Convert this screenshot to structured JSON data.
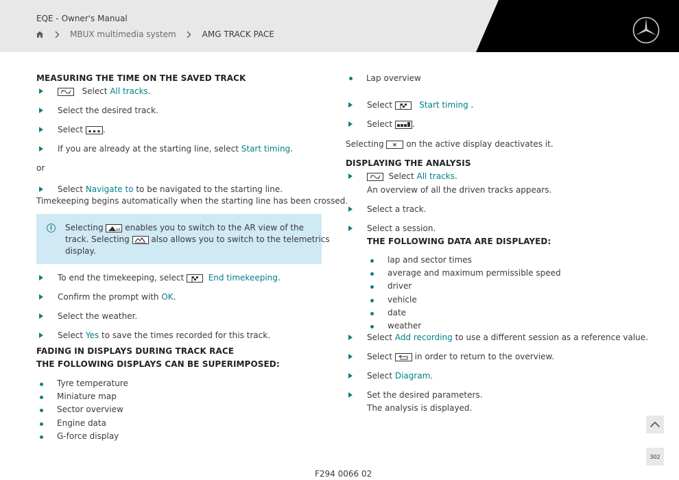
{
  "header": {
    "doc_title": "EQE - Owner's Manual",
    "breadcrumb": [
      "MBUX multimedia system",
      "AMG TRACK PACE"
    ]
  },
  "left": {
    "h1": "MEASURING THE TIME ON THE SAVED TRACK",
    "s1_pre": "Select ",
    "s1_link": "All tracks",
    "s1_post": ".",
    "s2": "Select the desired track.",
    "s3_pre": "Select ",
    "s3_post": ".",
    "s4_pre": "If you are already at the starting line, select ",
    "s4_link": "Start timing",
    "s4_post": ".",
    "or": "or",
    "s5_pre": "Select ",
    "s5_link": "Navigate to",
    "s5_post": " to be navigated to the starting line.",
    "s5_note": "Timekeeping begins automatically when the starting line has been crossed.",
    "info_l1_pre": "Selecting ",
    "info_l1_post": " enables you to switch to the AR view of the",
    "info_l2_pre": "track. Selecting ",
    "info_l2_post": " also allows you to switch to the telemetrics",
    "info_l3": "display.",
    "s6_pre": "To end the timekeeping, select ",
    "s6_link": "End timekeeping",
    "s6_post": ".",
    "s7_pre": "Confirm the prompt with ",
    "s7_link": "OK",
    "s7_post": ".",
    "s8": "Select the weather.",
    "s9_pre": "Select ",
    "s9_link": "Yes",
    "s9_post": " to save the times recorded for this track.",
    "h2": "FADING IN DISPLAYS DURING TRACK RACE",
    "h3": "THE FOLLOWING DISPLAYS CAN BE SUPERIMPOSED:",
    "bullets": [
      "Tyre temperature",
      "Miniature map",
      "Sector overview",
      "Engine data",
      "G-force display"
    ]
  },
  "right": {
    "lap": "Lap overview",
    "r1_pre": "Select ",
    "r1_link": "Start timing",
    "r1_post": " .",
    "r2_pre": "Select ",
    "r2_post": ".",
    "r3_pre": "Selecting ",
    "r3_post": " on the active display deactivates it.",
    "h1": "DISPLAYING THE ANALYSIS",
    "r4_pre": "Select ",
    "r4_link": "All tracks",
    "r4_post": ".",
    "r4_note": "An overview of all the driven tracks appears.",
    "r5": "Select a track.",
    "r6": "Select a session.",
    "h2": "THE FOLLOWING DATA ARE DISPLAYED:",
    "bullets": [
      "lap and sector times",
      "average and maximum permissible speed",
      "driver",
      "vehicle",
      "date",
      "weather"
    ],
    "r7_pre": "Select ",
    "r7_link": "Add recording",
    "r7_post": " to use a different session as a reference value.",
    "r8_pre": "Select ",
    "r8_post": " in order to return to the overview.",
    "r9_pre": "Select ",
    "r9_link": "Diagram",
    "r9_post": ".",
    "r10": "Set the desired parameters.",
    "r10_note": "The analysis is displayed."
  },
  "footer": {
    "code": "F294 0066 02",
    "page": "302"
  },
  "colors": {
    "accent": "#0d7f7f",
    "link": "#00808a",
    "info_bg": "#cfe9f5",
    "header_bg": "#e8e8e8"
  }
}
